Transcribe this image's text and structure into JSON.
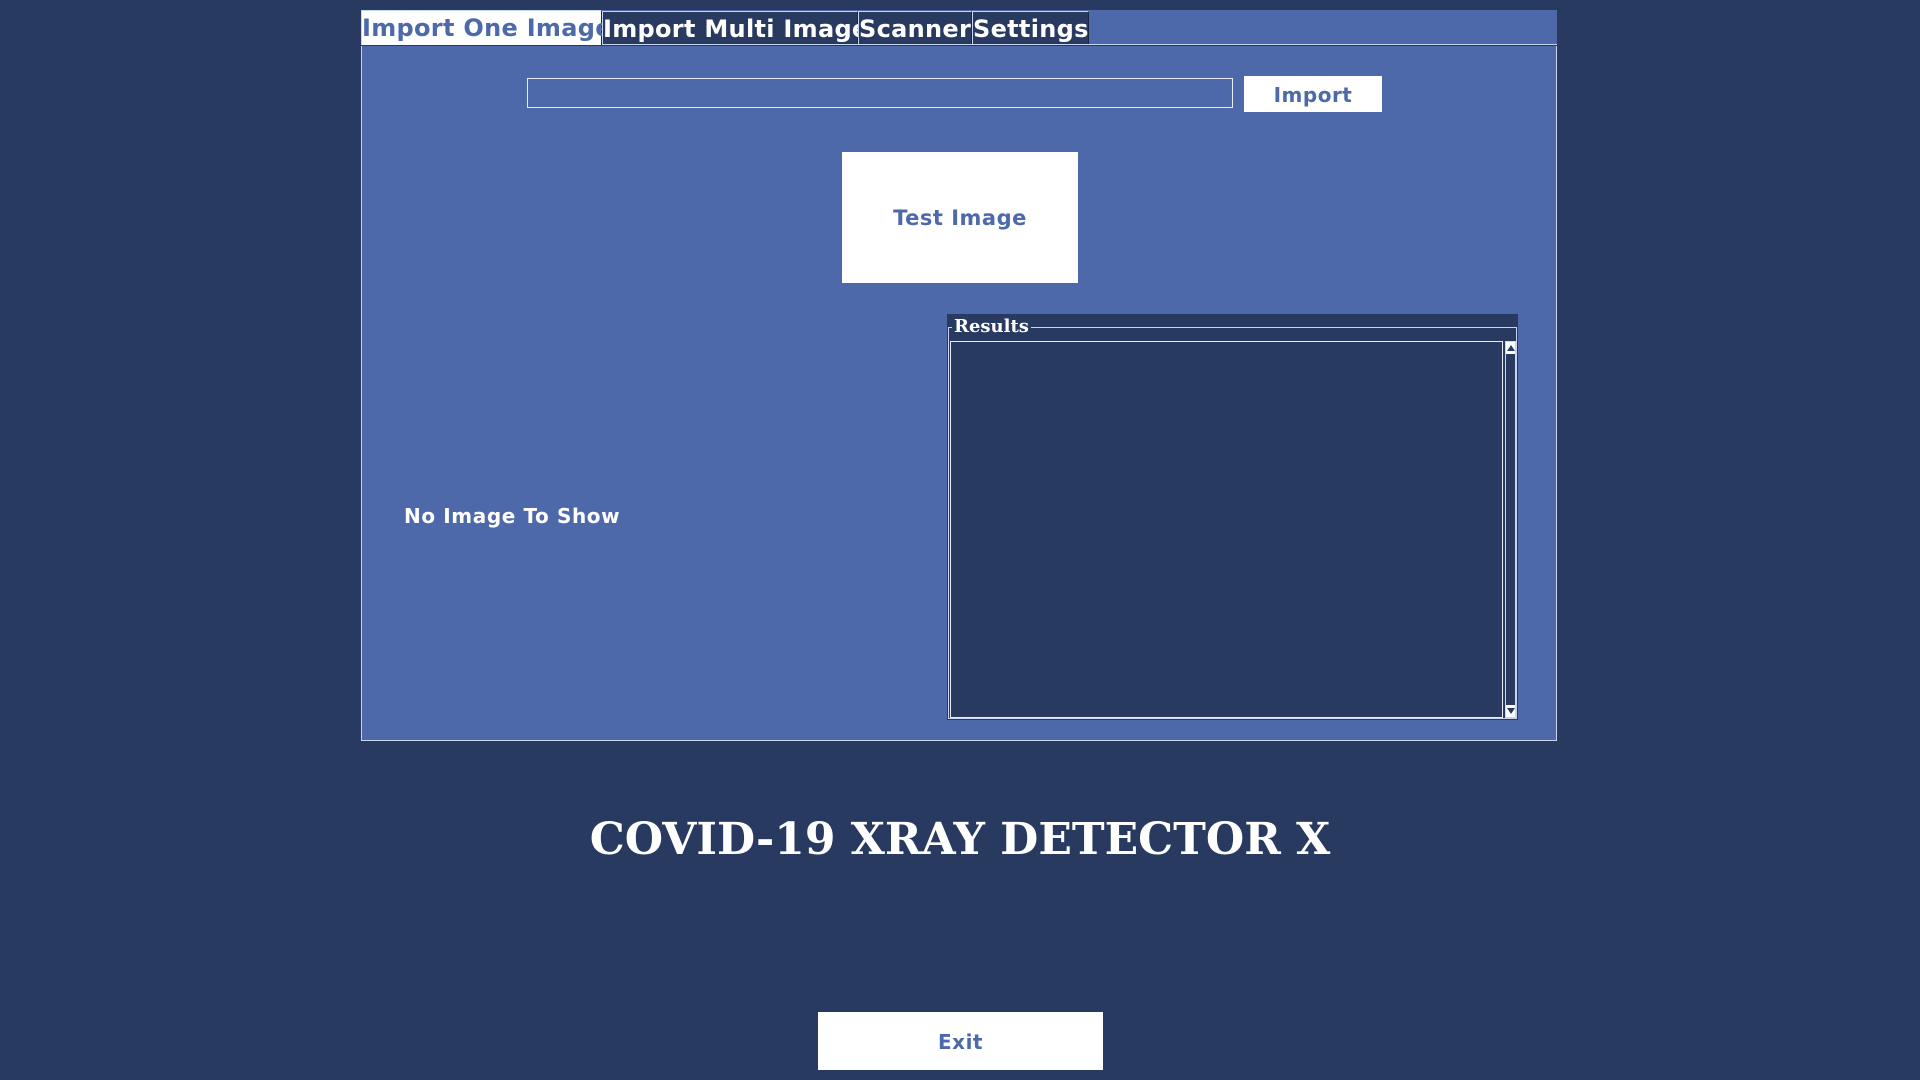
{
  "tabs": [
    {
      "label": "Import One Image",
      "active": true
    },
    {
      "label": "Import Multi Image",
      "active": false
    },
    {
      "label": "Scanner",
      "active": false
    },
    {
      "label": "Settings",
      "active": false
    }
  ],
  "import_panel": {
    "path_value": "",
    "path_placeholder": "",
    "import_label": "Import",
    "test_label": "Test Image",
    "no_image_label": "No Image To Show"
  },
  "results": {
    "legend": "Results",
    "text": ""
  },
  "app": {
    "title": "COVID-19 XRAY DETECTOR X",
    "exit_label": "Exit"
  },
  "colors": {
    "background": "#293a61",
    "panel": "#4d69aa",
    "button": "#ffffff",
    "button_text": "#4d69aa"
  }
}
